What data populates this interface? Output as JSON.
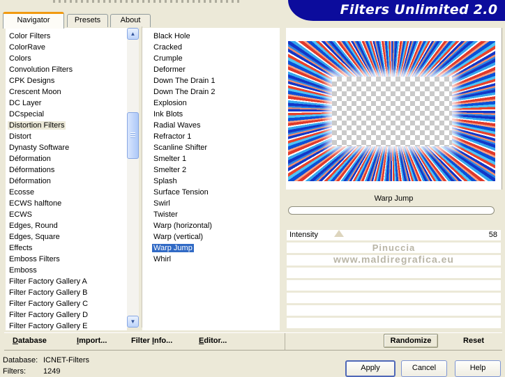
{
  "title_banner": {
    "text": "Filters Unlimited 2.0"
  },
  "colors": {
    "banner": "#0c0c9c",
    "background": "#ece9d8",
    "selection_blue": "#316ac5",
    "active_tab_accent": "#f19a10"
  },
  "icons": {
    "scroll_up": "▲",
    "scroll_down": "▼"
  },
  "tabs": {
    "active_index": 0,
    "items": [
      {
        "label": "Navigator"
      },
      {
        "label": "Presets"
      },
      {
        "label": "About"
      }
    ]
  },
  "left_list": {
    "highlighted_index": 8,
    "items": [
      "Color Filters",
      "ColorRave",
      "Colors",
      "Convolution Filters",
      "CPK Designs",
      "Crescent Moon",
      "DC Layer",
      "DCspecial",
      "Distortion Filters",
      "Distort",
      "Dynasty Software",
      "Déformation",
      "Déformations",
      "Déformation",
      "Ecosse",
      "ECWS halftone",
      "ECWS",
      "Edges, Round",
      "Edges, Square",
      "Effects",
      "Emboss Filters",
      "Emboss",
      "Filter Factory Gallery A",
      "Filter Factory Gallery B",
      "Filter Factory Gallery C",
      "Filter Factory Gallery D",
      "Filter Factory Gallery E"
    ]
  },
  "middle_list": {
    "selected_index": 19,
    "items": [
      "Black Hole",
      "Cracked",
      "Crumple",
      "Deformer",
      "Down The Drain 1",
      "Down The Drain 2",
      "Explosion",
      "Ink Blots",
      "Radial Waves",
      "Refractor 1",
      "Scanline Shifter",
      "Smelter 1",
      "Smelter 2",
      "Splash",
      "Surface Tension",
      "Swirl",
      "Twister",
      "Warp (horizontal)",
      "Warp (vertical)",
      "Warp Jump",
      "Whirl"
    ]
  },
  "preview": {
    "selected_filter_label": "Warp Jump"
  },
  "sliders": [
    {
      "name": "Intensity",
      "value": "58",
      "thumb_percent": 22
    },
    {
      "name": "",
      "value": ""
    },
    {
      "name": "",
      "value": ""
    },
    {
      "name": "",
      "value": ""
    },
    {
      "name": "",
      "value": ""
    },
    {
      "name": "",
      "value": ""
    },
    {
      "name": "",
      "value": ""
    },
    {
      "name": "",
      "value": ""
    }
  ],
  "watermark": {
    "line1": "Pinuccia",
    "line2": "www.maldiregrafica.eu"
  },
  "toolbar": {
    "items": [
      {
        "pre": "",
        "key": "D",
        "post": "atabase"
      },
      {
        "pre": "",
        "key": "I",
        "post": "mport..."
      },
      {
        "pre": "Filter ",
        "key": "I",
        "post": "nfo..."
      },
      {
        "pre": "",
        "key": "E",
        "post": "ditor..."
      }
    ],
    "randomize_label": "Randomize",
    "reset_label": "Reset"
  },
  "status": {
    "database_label": "Database:",
    "database_value": "ICNET-Filters",
    "filters_label": "Filters:",
    "filters_value": "1249"
  },
  "footer_buttons": {
    "apply": "Apply",
    "cancel": "Cancel",
    "help": "Help"
  }
}
